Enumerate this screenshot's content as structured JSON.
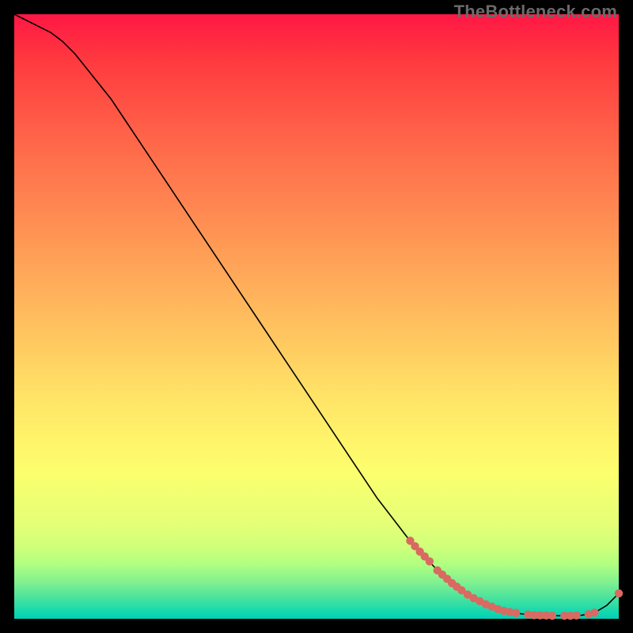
{
  "watermark": "TheBottleneck.com",
  "chart_data": {
    "type": "line",
    "title": "",
    "xlabel": "",
    "ylabel": "",
    "xlim": [
      0,
      100
    ],
    "ylim": [
      0,
      100
    ],
    "grid": false,
    "legend": false,
    "series": [
      {
        "name": "curve",
        "x": [
          0,
          2,
          4,
          6,
          8,
          10,
          12,
          14,
          16,
          18,
          20,
          25,
          30,
          35,
          40,
          45,
          50,
          55,
          60,
          65,
          70,
          75,
          78,
          80,
          82,
          84,
          86,
          88,
          90,
          92,
          94,
          96,
          98,
          100
        ],
        "y": [
          100,
          99,
          98,
          97,
          95.5,
          93.5,
          91,
          88.5,
          86,
          83,
          80,
          72.5,
          65,
          57.5,
          50,
          42.5,
          35,
          27.5,
          20,
          13.5,
          8,
          4,
          2.4,
          1.6,
          1.1,
          0.8,
          0.6,
          0.55,
          0.5,
          0.5,
          0.6,
          1.0,
          2.2,
          4.2
        ]
      }
    ],
    "highlight_points": [
      {
        "x": 65.5,
        "y": 12.9
      },
      {
        "x": 66.3,
        "y": 12.0
      },
      {
        "x": 67.1,
        "y": 11.1
      },
      {
        "x": 67.9,
        "y": 10.3
      },
      {
        "x": 68.7,
        "y": 9.5
      },
      {
        "x": 70.0,
        "y": 8.0
      },
      {
        "x": 70.8,
        "y": 7.3
      },
      {
        "x": 71.6,
        "y": 6.6
      },
      {
        "x": 72.4,
        "y": 5.9
      },
      {
        "x": 73.2,
        "y": 5.3
      },
      {
        "x": 74.0,
        "y": 4.7
      },
      {
        "x": 75.0,
        "y": 4.0
      },
      {
        "x": 76.0,
        "y": 3.4
      },
      {
        "x": 77.0,
        "y": 2.9
      },
      {
        "x": 78.0,
        "y": 2.4
      },
      {
        "x": 79.0,
        "y": 2.0
      },
      {
        "x": 80.0,
        "y": 1.6
      },
      {
        "x": 81.0,
        "y": 1.3
      },
      {
        "x": 82.0,
        "y": 1.1
      },
      {
        "x": 83.0,
        "y": 0.95
      },
      {
        "x": 85.0,
        "y": 0.7
      },
      {
        "x": 86.0,
        "y": 0.6
      },
      {
        "x": 87.0,
        "y": 0.57
      },
      {
        "x": 88.0,
        "y": 0.55
      },
      {
        "x": 89.0,
        "y": 0.5
      },
      {
        "x": 91.0,
        "y": 0.5
      },
      {
        "x": 92.0,
        "y": 0.5
      },
      {
        "x": 93.0,
        "y": 0.55
      },
      {
        "x": 95.0,
        "y": 0.75
      },
      {
        "x": 96.0,
        "y": 1.0
      },
      {
        "x": 100.0,
        "y": 4.2
      }
    ],
    "colors": {
      "line": "#000000",
      "points": "#d86a62",
      "gradient_top": "#ff1744",
      "gradient_bottom": "#00d0b8"
    }
  }
}
